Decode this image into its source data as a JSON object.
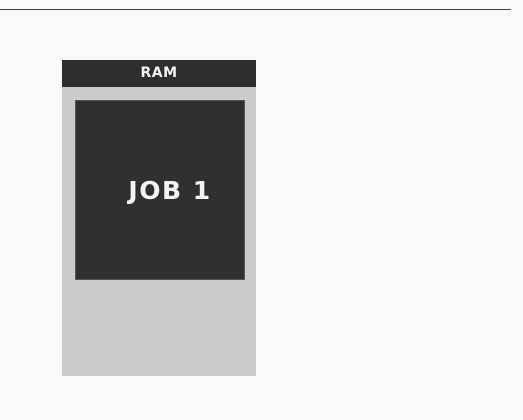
{
  "diagram": {
    "memory_label": "RAM",
    "job_label": "JOB 1"
  },
  "colors": {
    "background": "#f9f9f9",
    "memory_fill": "#cbcbcb",
    "memory_header": "#2e2e2e",
    "job_fill": "#303030",
    "text_light": "#f4f4f4"
  }
}
